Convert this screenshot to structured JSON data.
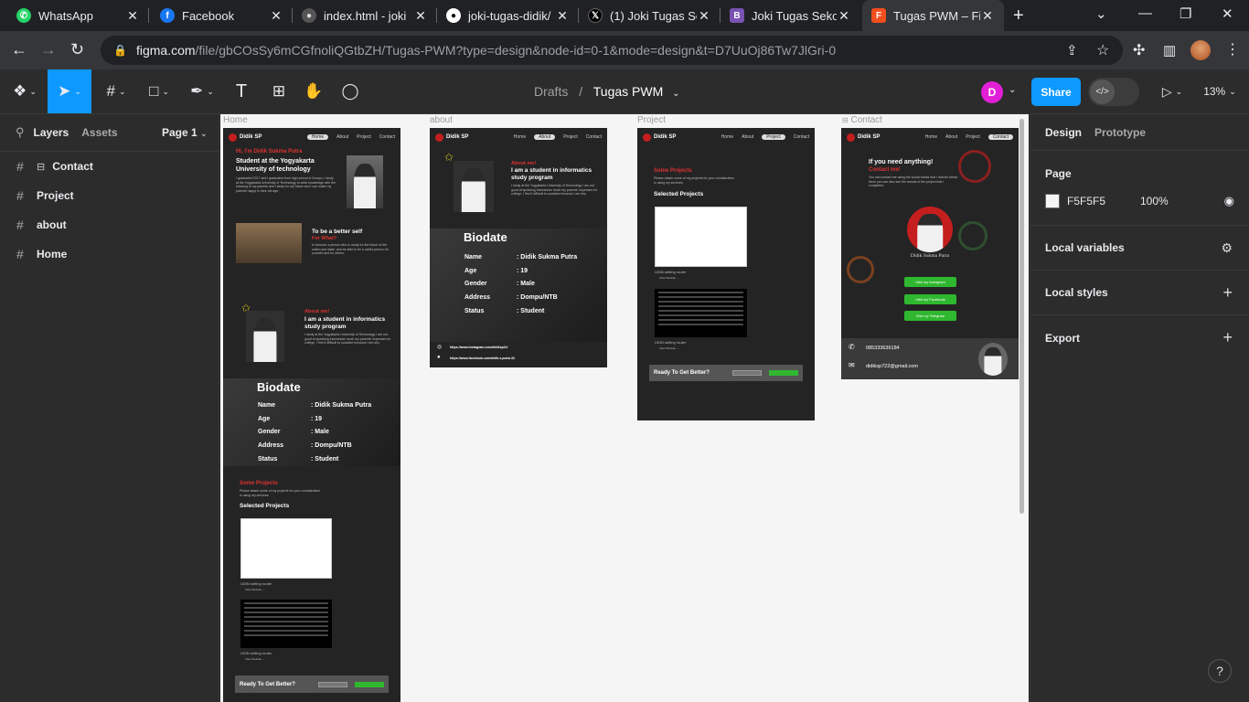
{
  "tabs": [
    {
      "title": "WhatsApp",
      "icon": "whatsapp-icon",
      "color": "#25d366"
    },
    {
      "title": "Facebook",
      "icon": "facebook-icon",
      "color": "#1877f2"
    },
    {
      "title": "index.html - joki",
      "icon": "github-icon",
      "color": "#555555"
    },
    {
      "title": "joki-tugas-didik/",
      "icon": "github-icon",
      "color": "#ffffff"
    },
    {
      "title": "(1) Joki Tugas Se",
      "icon": "x-icon",
      "color": "#000000"
    },
    {
      "title": "Joki Tugas Sekol",
      "icon": "bootstrap-icon",
      "color": "#7952b3"
    },
    {
      "title": "Tugas PWM – Fi",
      "icon": "figma-icon",
      "color": "#f24e1e"
    }
  ],
  "url": {
    "host": "figma.com",
    "path": "/file/gbCOsSy6mCGfnoliQGtbZH/Tugas-PWM?type=design&node-id=0-1&mode=design&t=D7UuOj86Tw7JlGri-0"
  },
  "toolbar": {
    "drafts": "Drafts",
    "separator": "/",
    "file_name": "Tugas PWM",
    "user_initial": "D",
    "share": "Share",
    "zoom": "13%"
  },
  "left_panel": {
    "tab_layers": "Layers",
    "tab_assets": "Assets",
    "page": "Page 1",
    "layers": [
      "Contact",
      "Project",
      "about",
      "Home"
    ]
  },
  "canvas": {
    "frame_labels": {
      "home": "Home",
      "about": "about",
      "project": "Project",
      "contact": "Contact"
    },
    "brand": "Didik SP",
    "nav": [
      "Home",
      "About",
      "Project",
      "Contact"
    ],
    "home": {
      "hi": "Hi, I'm Didik Sukma Putra",
      "headline": "Student at the Yogyakarta University of technology",
      "intro": "I graduated 2017 and I graduated from high school in Dompu. I study at the Yogyakarta University of Technology to seek knowledge with the blessing of my parents and I study for my future and I can make my parents happy in their old age.",
      "better_title": "To be a better self",
      "for_what": "For What?",
      "better_text": "to become a person who is ready for the future of the nation and state, and be able to be a useful person for yourself and for others."
    },
    "about": {
      "about_me": "About me!",
      "headline": "I am a student in informatics study program",
      "text": "I study at the Yogyakarta University of Technology I am not good at speaking Indonesian much my parents' expenses for college, I find it difficult to socialize because I am shy"
    },
    "biodate": {
      "title": "Biodate",
      "rows": [
        {
          "k": "Name",
          "v": ": Didik Sukma Putra"
        },
        {
          "k": "Age",
          "v": ": 19"
        },
        {
          "k": "Gender",
          "v": ": Male"
        },
        {
          "k": "Address",
          "v": ": Dompu/NTB"
        },
        {
          "k": "Status",
          "v": ": Student"
        }
      ]
    },
    "social_links": {
      "instagram": "https://www.instagram.com/didiksp11/",
      "facebook": "https://www.facebook.com/didik.s.putra.33"
    },
    "projects": {
      "some": "Some Projects",
      "intro": "Please attach some of my projects for your consideration in using my services.",
      "selected": "Selected Projects",
      "caption1": "UDIN setting router",
      "caption2": "UDIN setting router",
      "view": "View Website →",
      "cta": "Ready To Get Better?"
    },
    "contact": {
      "need": "If you need anything!",
      "contact_me": "Contact me!",
      "text": "You can contact me using the social media that I include below there you can also see the results of the project that I completed.",
      "name": "Didik Sukma Putra",
      "btn1": "Visit my instagram",
      "btn2": "Visit my Facebook",
      "btn3": "Visit my Telegram",
      "phone": "085333636184",
      "email": "didiksp722@gmail.com"
    }
  },
  "right_panel": {
    "tab_design": "Design",
    "tab_prototype": "Prototype",
    "page_label": "Page",
    "bg_hex": "F5F5F5",
    "bg_opacity": "100%",
    "local_variables": "Local variables",
    "local_styles": "Local styles",
    "export": "Export"
  },
  "help": "?"
}
